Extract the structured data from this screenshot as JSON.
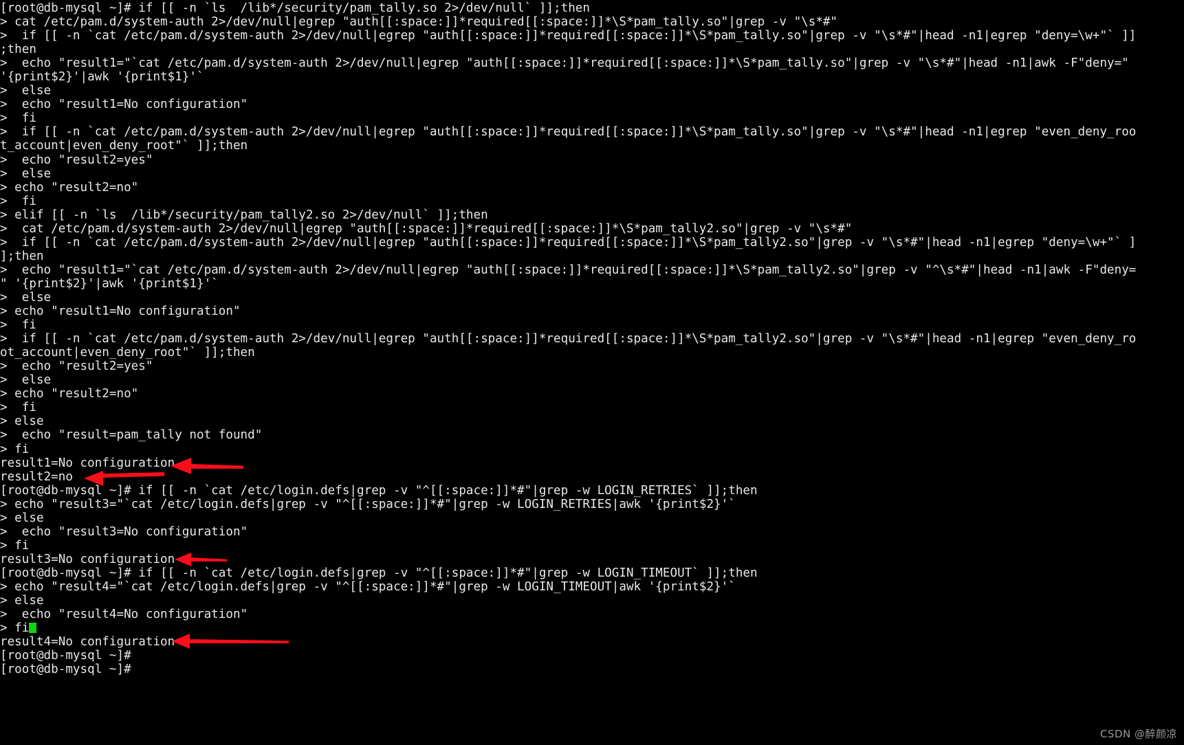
{
  "terminal": {
    "title": "root@db-mysql terminal session",
    "background_color": "#000000",
    "foreground_color": "#e8e8e8",
    "cursor_color": "#12d312",
    "annotation_color": "#fc0d1b",
    "prompt": "[root@db-mysql ~]#",
    "continuation_prompt": ">",
    "lines": [
      "[root@db-mysql ~]# if [[ -n `ls  /lib*/security/pam_tally.so 2>/dev/null` ]];then",
      "> cat /etc/pam.d/system-auth 2>/dev/null|egrep \"auth[[:space:]]*required[[:space:]]*\\S*pam_tally.so\"|grep -v \"\\s*#\"",
      ">  if [[ -n `cat /etc/pam.d/system-auth 2>/dev/null|egrep \"auth[[:space:]]*required[[:space:]]*\\S*pam_tally.so\"|grep -v \"\\s*#\"|head -n1|egrep \"deny=\\w+\"` ]]",
      ";then",
      ">  echo \"result1=\"`cat /etc/pam.d/system-auth 2>/dev/null|egrep \"auth[[:space:]]*required[[:space:]]*\\S*pam_tally.so\"|grep -v \"\\s*#\"|head -n1|awk -F\"deny=\"",
      "'{print$2}'|awk '{print$1}'`",
      ">  else",
      ">  echo \"result1=No configuration\"",
      ">  fi",
      ">  if [[ -n `cat /etc/pam.d/system-auth 2>/dev/null|egrep \"auth[[:space:]]*required[[:space:]]*\\S*pam_tally.so\"|grep -v \"\\s*#\"|head -n1|egrep \"even_deny_roo",
      "t_account|even_deny_root\"` ]];then",
      ">  echo \"result2=yes\"",
      ">  else",
      "> echo \"result2=no\"",
      ">  fi",
      "> elif [[ -n `ls  /lib*/security/pam_tally2.so 2>/dev/null` ]];then",
      ">  cat /etc/pam.d/system-auth 2>/dev/null|egrep \"auth[[:space:]]*required[[:space:]]*\\S*pam_tally2.so\"|grep -v \"\\s*#\"",
      ">  if [[ -n `cat /etc/pam.d/system-auth 2>/dev/null|egrep \"auth[[:space:]]*required[[:space:]]*\\S*pam_tally2.so\"|grep -v \"\\s*#\"|head -n1|egrep \"deny=\\w+\"` ]",
      "];then",
      ">  echo \"result1=\"`cat /etc/pam.d/system-auth 2>/dev/null|egrep \"auth[[:space:]]*required[[:space:]]*\\S*pam_tally2.so\"|grep -v \"^\\s*#\"|head -n1|awk -F\"deny=",
      "\" '{print$2}'|awk '{print$1}'`",
      ">  else",
      "> echo \"result1=No configuration\"",
      ">  fi",
      ">  if [[ -n `cat /etc/pam.d/system-auth 2>/dev/null|egrep \"auth[[:space:]]*required[[:space:]]*\\S*pam_tally2.so\"|grep -v \"\\s*#\"|head -n1|egrep \"even_deny_ro",
      "ot_account|even_deny_root\"` ]];then",
      ">  echo \"result2=yes\"",
      ">  else",
      "> echo \"result2=no\"",
      ">  fi",
      "> else",
      ">  echo \"result=pam_tally not found\"",
      "> fi",
      "result1=No configuration",
      "result2=no",
      "[root@db-mysql ~]# if [[ -n `cat /etc/login.defs|grep -v \"^[[:space:]]*#\"|grep -w LOGIN_RETRIES` ]];then",
      "> echo \"result3=\"`cat /etc/login.defs|grep -v \"^[[:space:]]*#\"|grep -w LOGIN_RETRIES|awk '{print$2}'`",
      "> else",
      ">  echo \"result3=No configuration\"",
      "> fi",
      "result3=No configuration",
      "[root@db-mysql ~]# if [[ -n `cat /etc/login.defs|grep -v \"^[[:space:]]*#\"|grep -w LOGIN_TIMEOUT` ]];then",
      "> echo \"result4=\"`cat /etc/login.defs|grep -v \"^[[:space:]]*#\"|grep -w LOGIN_TIMEOUT|awk '{print$2}'`",
      "> else",
      ">  echo \"result4=No configuration\"",
      "> fi",
      "result4=No configuration",
      "[root@db-mysql ~]#",
      "[root@db-mysql ~]# "
    ],
    "cursor_line_index": 45
  },
  "annotations": [
    {
      "name": "arrow-result1",
      "points_at": "result1=No configuration",
      "color": "#fc0d1b"
    },
    {
      "name": "arrow-result2",
      "points_at": "result2=no",
      "color": "#fc0d1b"
    },
    {
      "name": "arrow-result3",
      "points_at": "result3=No configuration",
      "color": "#fc0d1b"
    },
    {
      "name": "arrow-result4",
      "points_at": "result4=No configuration",
      "color": "#fc0d1b"
    }
  ],
  "watermark": {
    "text": "CSDN @醉颜凉"
  }
}
